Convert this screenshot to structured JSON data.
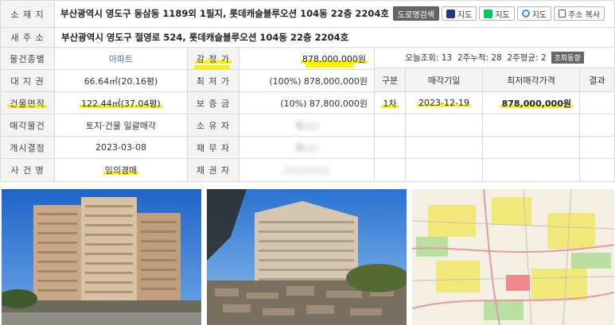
{
  "address": {
    "lot_label": "소 재 지",
    "lot_value": "부산광역시 영도구 동삼동 1189외 1필지, 롯데캐슬블루오션 104동 22층 2204호",
    "road_label": "새 주 소",
    "road_value": "부산광역시 영도구 절영로 524, 롯데캐슬블루오션 104동 22층 2204호",
    "buttons": {
      "road_search": "도로명검색",
      "daum_map": "지도",
      "naver_map": "지도",
      "google_map": "지도",
      "copy_address": "주소 복사"
    }
  },
  "info": {
    "property_type_label": "물건종별",
    "property_type_value": "아파트",
    "land_right_label": "대 지 권",
    "land_right_value": "66.64㎡(20.16평)",
    "building_area_label": "건물면적",
    "building_area_value": "122.44㎡(37.04평)",
    "sale_object_label": "매각물건",
    "sale_object_value": "토지·건물 일괄매각",
    "decision_label": "개시결정",
    "decision_value": "2023-03-08",
    "case_type_label": "사 건 명",
    "case_type_value": "임의경매",
    "appraisal_label": "감 정 가",
    "appraisal_value": "878,000,000원",
    "minimum_label": "최 저 가",
    "minimum_value": "(100%) 878,000,000원",
    "deposit_label": "보 증 금",
    "deposit_value": "(10%) 87,800,000원",
    "owner_label": "소 유 자",
    "owner_value": "최○○",
    "debtor_label": "채 무 자",
    "debtor_value": "최○○",
    "creditor_label": "채 권 자",
    "creditor_value": "○○○○○○"
  },
  "stats": {
    "views_text": "오늘조회: 13  2주누적: 28  2주평균: 2",
    "views_button": "조회동향"
  },
  "auction_table": {
    "headers": [
      "구분",
      "매각기일",
      "최저매각가격",
      "결과"
    ],
    "rows": [
      [
        "1차",
        "2023-12-19",
        "878,000,000원",
        ""
      ]
    ]
  },
  "colors": {
    "highlight": "#fff200",
    "label_bg": "#f3f3f3",
    "border": "#d9d9d9",
    "link": "#3a6fb5"
  }
}
